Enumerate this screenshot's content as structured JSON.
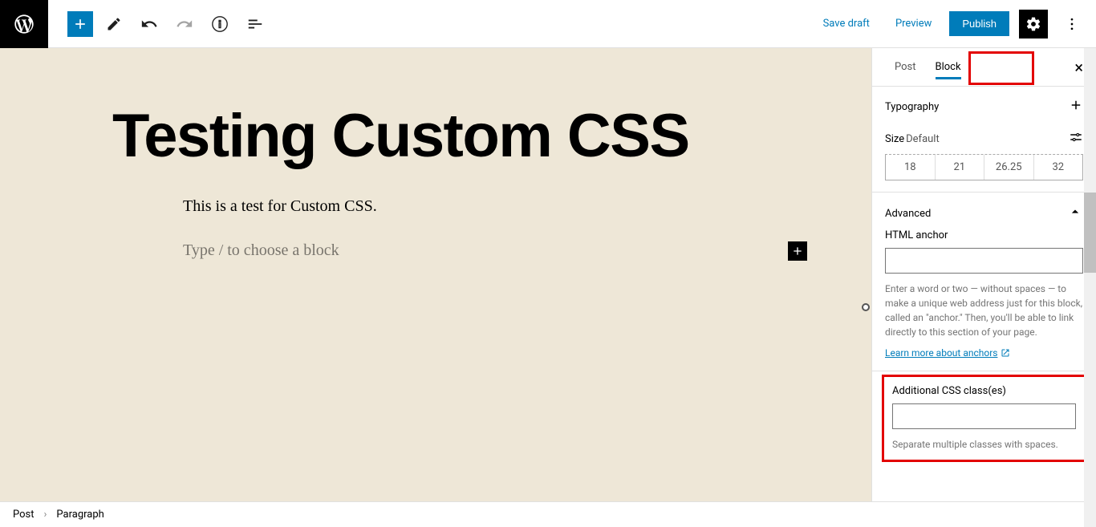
{
  "toolbar": {
    "save_draft": "Save draft",
    "preview": "Preview",
    "publish": "Publish"
  },
  "editor": {
    "title": "Testing Custom CSS",
    "paragraph": "This is a test for Custom CSS.",
    "placeholder": "Type / to choose a block"
  },
  "sidebar": {
    "tab_post": "Post",
    "tab_block": "Block",
    "typography": {
      "title": "Typography",
      "size_label": "Size",
      "size_value": "Default",
      "presets": [
        "18",
        "21",
        "26.25",
        "32"
      ]
    },
    "advanced": {
      "title": "Advanced",
      "html_anchor_label": "HTML anchor",
      "html_anchor_value": "",
      "anchor_help": "Enter a word or two — without spaces — to make a unique web address just for this block, called an \"anchor.\" Then, you'll be able to link directly to this section of your page.",
      "anchor_link": "Learn more about anchors",
      "css_classes_label": "Additional CSS class(es)",
      "css_classes_value": "",
      "css_classes_help": "Separate multiple classes with spaces."
    }
  },
  "breadcrumb": {
    "post": "Post",
    "paragraph": "Paragraph"
  }
}
